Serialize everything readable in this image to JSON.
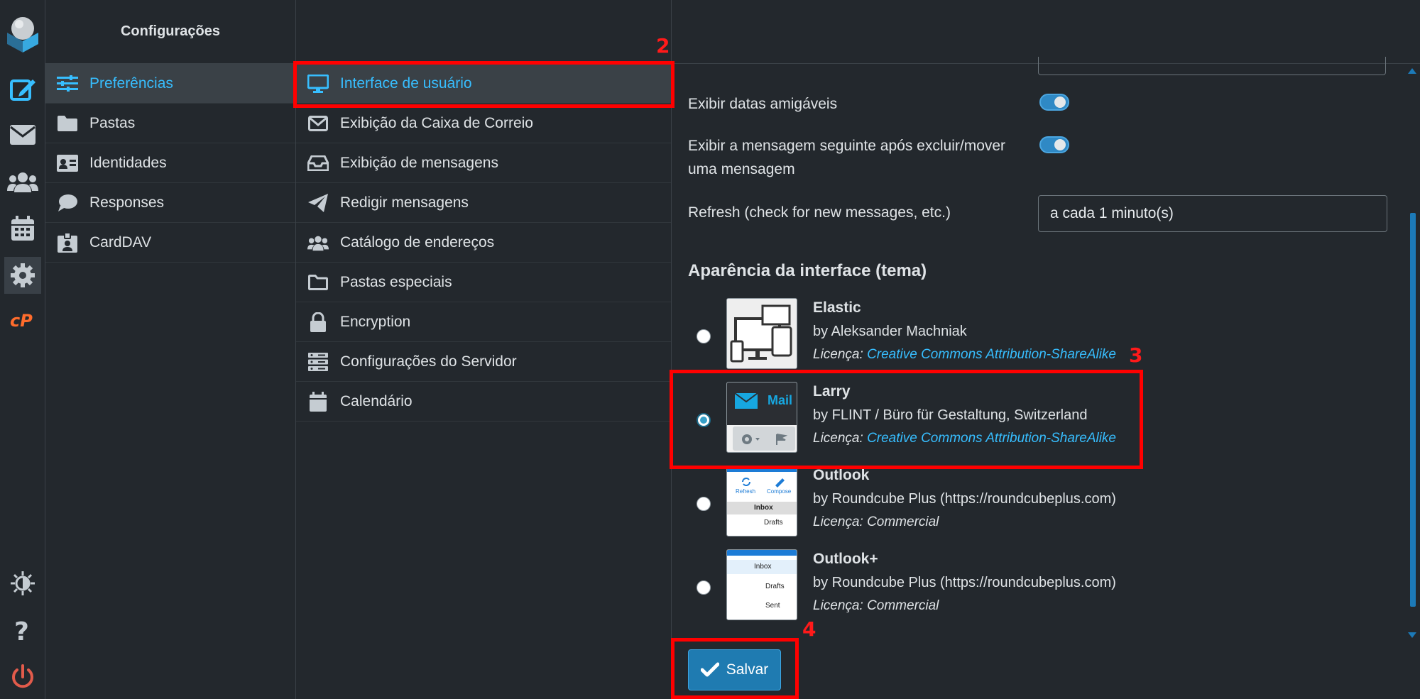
{
  "settings_column": {
    "title": "Configurações",
    "items": [
      {
        "label": "Preferências",
        "icon": "sliders-icon",
        "selected": true
      },
      {
        "label": "Pastas",
        "icon": "folder-icon"
      },
      {
        "label": "Identidades",
        "icon": "id-card-icon"
      },
      {
        "label": "Responses",
        "icon": "comment-icon"
      },
      {
        "label": "CardDAV",
        "icon": "contact-badge-icon"
      }
    ]
  },
  "sections_column": {
    "items": [
      {
        "label": "Interface de usuário",
        "icon": "monitor-icon",
        "selected": true
      },
      {
        "label": "Exibição da Caixa de Correio",
        "icon": "envelope-icon"
      },
      {
        "label": "Exibição de mensagens",
        "icon": "inbox-tray-icon"
      },
      {
        "label": "Redigir mensagens",
        "icon": "paper-plane-icon"
      },
      {
        "label": "Catálogo de endereços",
        "icon": "users-icon"
      },
      {
        "label": "Pastas especiais",
        "icon": "folder-outline-icon"
      },
      {
        "label": "Encryption",
        "icon": "lock-icon"
      },
      {
        "label": "Configurações do Servidor",
        "icon": "server-icon"
      },
      {
        "label": "Calendário",
        "icon": "calendar-icon"
      }
    ]
  },
  "main": {
    "friendly_dates_label": "Exibir datas amigáveis",
    "friendly_dates_enabled": true,
    "next_message_label": "Exibir a mensagem seguinte após excluir/mover uma mensagem",
    "next_message_enabled": true,
    "refresh_label": "Refresh (check for new messages, etc.)",
    "refresh_value": "a cada 1 minuto(s)",
    "theme_section_title": "Aparência da interface (tema)",
    "license_prefix": "Licença:",
    "themes": [
      {
        "name": "Elastic",
        "by": "by Aleksander Machniak",
        "license": "Creative Commons Attribution-ShareAlike",
        "license_link": true,
        "selected": false
      },
      {
        "name": "Larry",
        "by": "by FLINT / Büro für Gestaltung, Switzerland",
        "license": "Creative Commons Attribution-ShareAlike",
        "license_link": true,
        "selected": true
      },
      {
        "name": "Outlook",
        "by": "by Roundcube Plus (https://roundcubeplus.com)",
        "license": "Commercial",
        "license_link": false,
        "selected": false
      },
      {
        "name": "Outlook+",
        "by": "by Roundcube Plus (https://roundcubeplus.com)",
        "license": "Commercial",
        "license_link": false,
        "selected": false
      }
    ],
    "thumbnails": {
      "larry_mail": "Mail",
      "outlook_refresh": "Refresh",
      "outlook_compose": "Compose",
      "outlook_inbox": "Inbox",
      "outlook_drafts": "Drafts",
      "outlookplus_inbox": "Inbox",
      "outlookplus_drafts": "Drafts",
      "outlookplus_sent": "Sent"
    },
    "save_label": "Salvar"
  },
  "annotations": [
    "2",
    "3",
    "4"
  ],
  "colors": {
    "accent": "#37beff",
    "background": "#23282d",
    "annotation": "#ff0000",
    "button": "#1f7bb1"
  }
}
